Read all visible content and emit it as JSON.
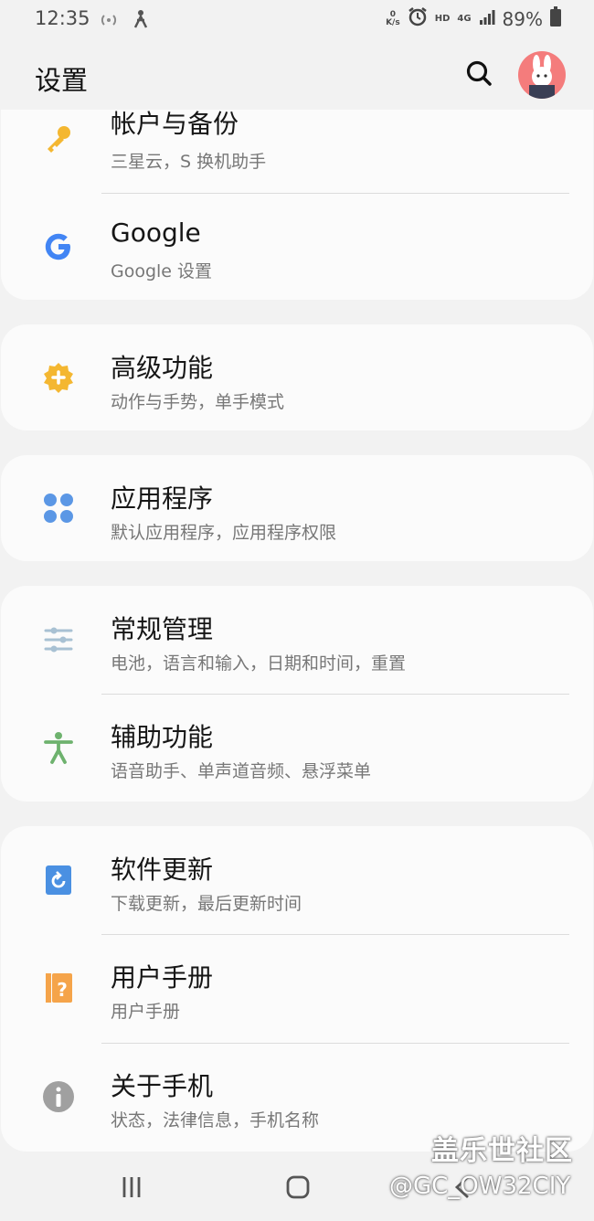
{
  "status_bar": {
    "time": "12:35",
    "net_speed_value": "0",
    "net_speed_unit": "K/s",
    "hd": "HD",
    "network": "4G",
    "battery": "89%"
  },
  "app_bar": {
    "title": "设置"
  },
  "items": [
    {
      "title": "帐户与备份",
      "sub": "三星云，S 换机助手",
      "icon": "key-icon",
      "color": "#f4b731"
    },
    {
      "title": "Google",
      "sub": "Google 设置",
      "icon": "google-icon",
      "color": "#4285f4"
    },
    {
      "title": "高级功能",
      "sub": "动作与手势，单手模式",
      "icon": "gear-plus-icon",
      "color": "#f4b731"
    },
    {
      "title": "应用程序",
      "sub": "默认应用程序，应用程序权限",
      "icon": "apps-grid-icon",
      "color": "#5b97e5"
    },
    {
      "title": "常规管理",
      "sub": "电池，语言和输入，日期和时间，重置",
      "icon": "sliders-icon",
      "color": "#a8c1d3"
    },
    {
      "title": "辅助功能",
      "sub": "语音助手、单声道音频、悬浮菜单",
      "icon": "accessibility-icon",
      "color": "#6eb26e"
    },
    {
      "title": "软件更新",
      "sub": "下载更新，最后更新时间",
      "icon": "software-update-icon",
      "color": "#4a90e2"
    },
    {
      "title": "用户手册",
      "sub": "用户手册",
      "icon": "user-manual-icon",
      "color": "#f5a44a"
    },
    {
      "title": "关于手机",
      "sub": "状态，法律信息，手机名称",
      "icon": "info-icon",
      "color": "#a0a0a0"
    }
  ],
  "watermark": {
    "line1": "盖乐世社区",
    "line2": "@GC_OW32CIY"
  }
}
